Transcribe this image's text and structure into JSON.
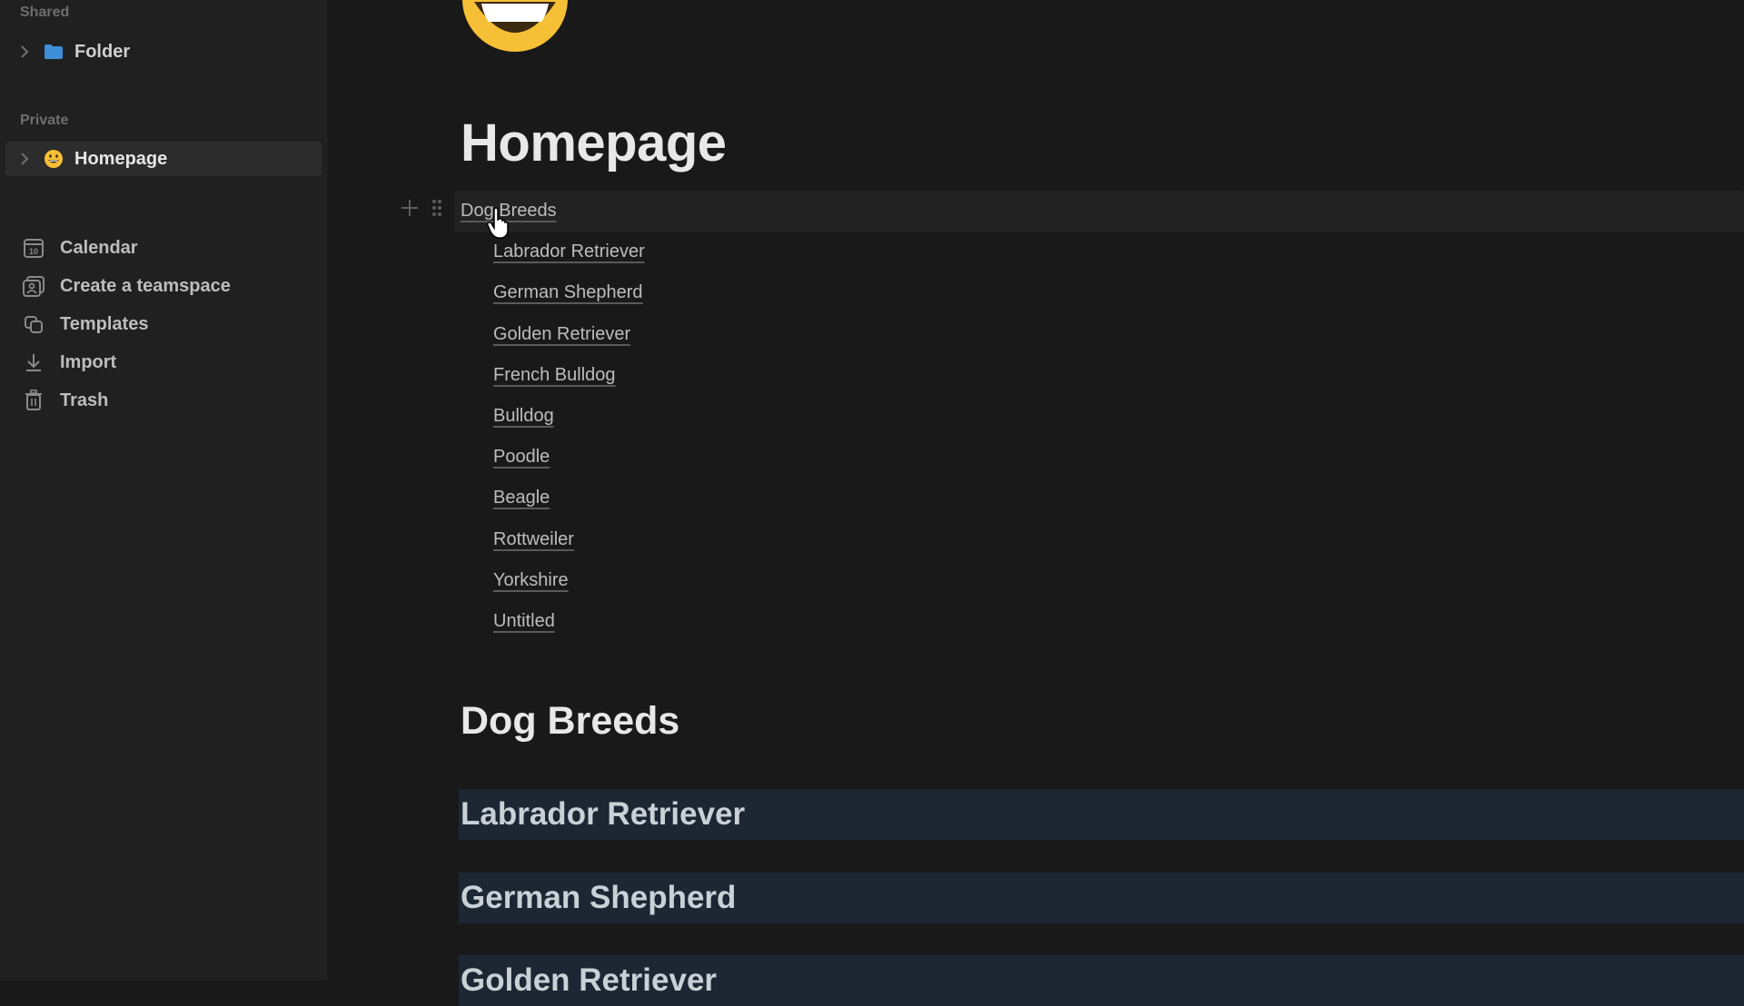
{
  "sidebar": {
    "shared_label": "Shared",
    "folder": {
      "label": "Folder",
      "icon": "folder-icon",
      "icon_color": "#3e8ed8"
    },
    "private_label": "Private",
    "homepage": {
      "label": "Homepage",
      "icon": "grinning-face-emoji"
    },
    "nav": [
      {
        "label": "Calendar",
        "icon": "calendar-icon"
      },
      {
        "label": "Create a teamspace",
        "icon": "teamspace-icon"
      },
      {
        "label": "Templates",
        "icon": "templates-icon"
      },
      {
        "label": "Import",
        "icon": "import-icon"
      },
      {
        "label": "Trash",
        "icon": "trash-icon"
      }
    ]
  },
  "page": {
    "emoji": "grinning-face-emoji",
    "title": "Homepage",
    "toc_heading": "Dog Breeds",
    "toc_items": [
      "Labrador Retriever",
      "German Shepherd",
      "Golden Retriever",
      "French Bulldog",
      "Bulldog",
      "Poodle",
      "Beagle",
      "Rottweiler",
      "Yorkshire",
      "Untitled"
    ],
    "section_heading": "Dog Breeds",
    "toggle_headings": [
      "Labrador Retriever",
      "German Shepherd",
      "Golden Retriever"
    ]
  },
  "colors": {
    "background": "#191919",
    "sidebar": "#202020",
    "toggle_heading_bg": "#1c2733",
    "folder_blue": "#3e8ed8",
    "emoji_yellow": "#f6c036"
  }
}
